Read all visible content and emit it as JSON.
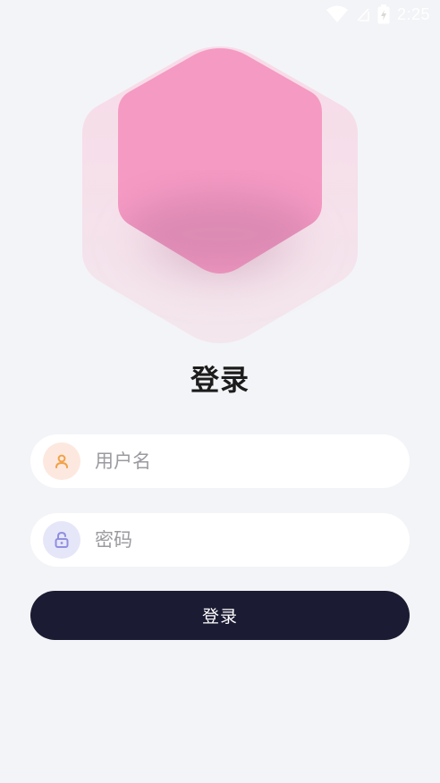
{
  "status_bar": {
    "time": "2:25"
  },
  "page": {
    "title": "登录"
  },
  "form": {
    "username_placeholder": "用户名",
    "password_placeholder": "密码",
    "login_label": "登录"
  },
  "icons": {
    "user": "person-icon",
    "password": "lock-icon"
  },
  "colors": {
    "background": "#f3f4f7",
    "hexagon": "#f59ac3",
    "button": "#1b1b33",
    "user_icon_bg": "#fde8df",
    "user_icon": "#f2a146",
    "lock_icon_bg": "#e6e6f9",
    "lock_icon": "#8f8fe0"
  }
}
